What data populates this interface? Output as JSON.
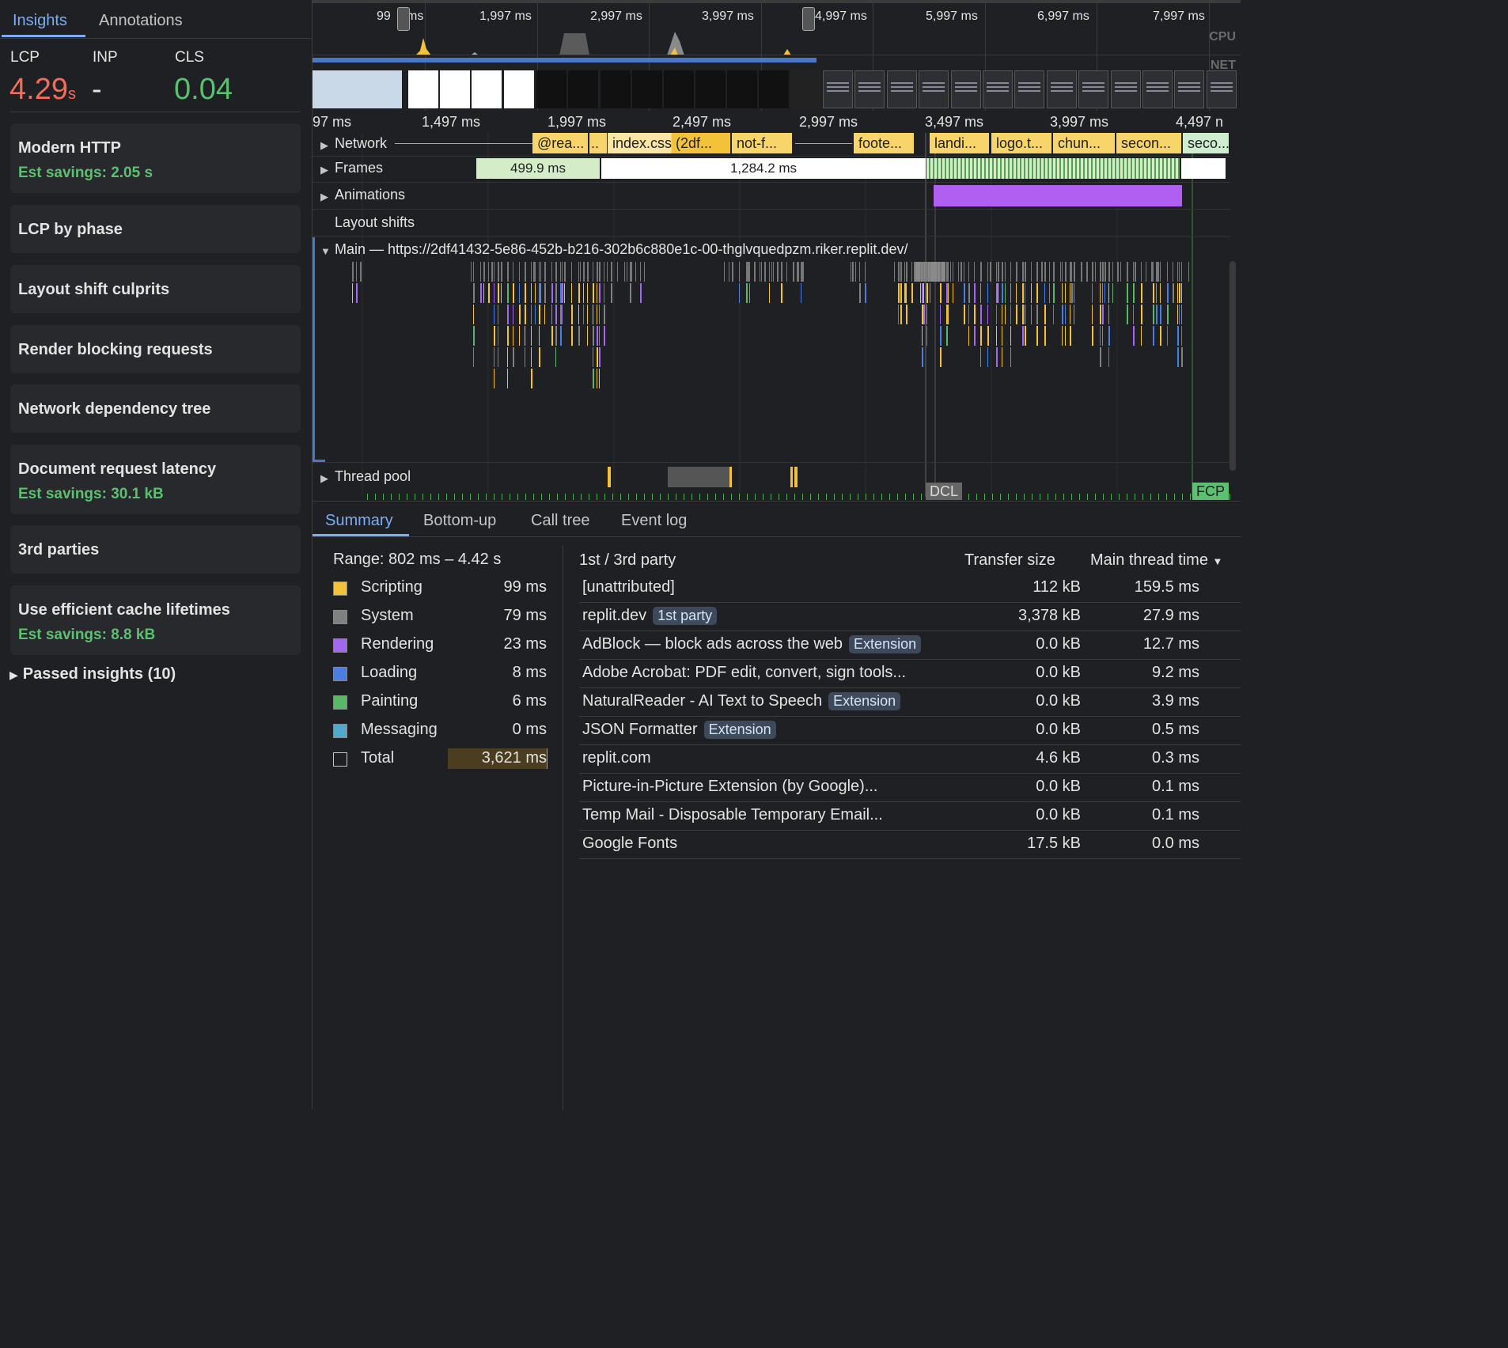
{
  "sidebar": {
    "tabs": [
      "Insights",
      "Annotations"
    ],
    "metrics": {
      "lcp_label": "LCP",
      "lcp_value": "4.29",
      "lcp_unit": "s",
      "inp_label": "INP",
      "inp_value": "-",
      "cls_label": "CLS",
      "cls_value": "0.04"
    },
    "cards": [
      {
        "title": "Modern HTTP",
        "sub": "Est savings: 2.05 s"
      },
      {
        "title": "LCP by phase",
        "sub": ""
      },
      {
        "title": "Layout shift culprits",
        "sub": ""
      },
      {
        "title": "Render blocking requests",
        "sub": ""
      },
      {
        "title": "Network dependency tree",
        "sub": ""
      },
      {
        "title": "Document request latency",
        "sub": "Est savings: 30.1 kB"
      },
      {
        "title": "3rd parties",
        "sub": ""
      },
      {
        "title": "Use efficient cache lifetimes",
        "sub": "Est savings: 8.8 kB"
      }
    ],
    "passed": "Passed insights (10)"
  },
  "overview": {
    "ticks": [
      "99",
      "ms",
      "1,997 ms",
      "2,997 ms",
      "3,997 ms",
      "4,997 ms",
      "5,997 ms",
      "6,997 ms",
      "7,997 ms"
    ],
    "cpu_label": "CPU",
    "net_label": "NET"
  },
  "ruler": {
    "ticks": [
      "97 ms",
      "1,497 ms",
      "1,997 ms",
      "2,497 ms",
      "2,997 ms",
      "3,497 ms",
      "3,997 ms",
      "4,497 n"
    ]
  },
  "tracks": {
    "network": "Network",
    "frames": "Frames",
    "animations": "Animations",
    "layout_shifts": "Layout shifts",
    "main": "Main — https://2df41432-5e86-452b-b216-302b6c880e1c-00-thglvquedpzm.riker.replit.dev/",
    "thread_pool": "Thread pool",
    "network_requests": [
      "@rea...",
      "..",
      "index.css (2df...",
      "not-f...",
      "foote...",
      "landi...",
      "logo.t...",
      "chun...",
      "secon...",
      "seco..."
    ],
    "frames_values": [
      "499.9 ms",
      "1,284.2 ms"
    ],
    "markers": {
      "dcl": "DCL",
      "fcp": "FCP"
    }
  },
  "bottom": {
    "tabs": [
      "Summary",
      "Bottom-up",
      "Call tree",
      "Event log"
    ],
    "range": "Range: 802 ms – 4.42 s",
    "categories": [
      {
        "name": "Scripting",
        "value": "99 ms",
        "color": "#f3c238"
      },
      {
        "name": "System",
        "value": "79 ms",
        "color": "#808080"
      },
      {
        "name": "Rendering",
        "value": "23 ms",
        "color": "#a467f0"
      },
      {
        "name": "Loading",
        "value": "8 ms",
        "color": "#4a7fe0"
      },
      {
        "name": "Painting",
        "value": "6 ms",
        "color": "#59b866"
      },
      {
        "name": "Messaging",
        "value": "0 ms",
        "color": "#56a8c8"
      },
      {
        "name": "Total",
        "value": "3,621 ms",
        "color": ""
      }
    ],
    "table": {
      "headers": [
        "1st / 3rd party",
        "Transfer size",
        "Main thread time"
      ],
      "rows": [
        {
          "name": "[unattributed]",
          "badge": "",
          "size": "112 kB",
          "time": "159.5 ms"
        },
        {
          "name": "replit.dev",
          "badge": "1st party",
          "size": "3,378 kB",
          "time": "27.9 ms"
        },
        {
          "name": "AdBlock — block ads across the web",
          "badge": "Extension",
          "size": "0.0 kB",
          "time": "12.7 ms"
        },
        {
          "name": "Adobe Acrobat: PDF edit, convert, sign tools...",
          "badge": "",
          "size": "0.0 kB",
          "time": "9.2 ms"
        },
        {
          "name": "NaturalReader - AI Text to Speech",
          "badge": "Extension",
          "size": "0.0 kB",
          "time": "3.9 ms"
        },
        {
          "name": "JSON Formatter",
          "badge": "Extension",
          "size": "0.0 kB",
          "time": "0.5 ms"
        },
        {
          "name": "replit.com",
          "badge": "",
          "size": "4.6 kB",
          "time": "0.3 ms"
        },
        {
          "name": "Picture-in-Picture Extension (by Google)...",
          "badge": "",
          "size": "0.0 kB",
          "time": "0.1 ms"
        },
        {
          "name": "Temp Mail - Disposable Temporary Email...",
          "badge": "",
          "size": "0.0 kB",
          "time": "0.1 ms"
        },
        {
          "name": "Google Fonts",
          "badge": "",
          "size": "17.5 kB",
          "time": "0.0 ms"
        }
      ]
    }
  }
}
